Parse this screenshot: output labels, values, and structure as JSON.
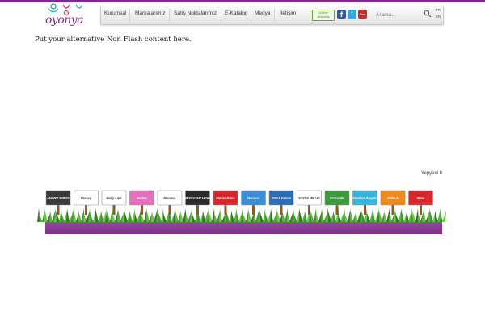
{
  "logo": {
    "text": "oyonya"
  },
  "nav": {
    "items": [
      {
        "label": "Kurumsal"
      },
      {
        "label": "Markalarımız"
      },
      {
        "label": "Satış Noktalarımız"
      },
      {
        "label": "E-Katalog"
      },
      {
        "label": "Medya"
      },
      {
        "label": "İletişim"
      }
    ],
    "online_store": {
      "line1": "Online",
      "line2": "Alışveriş"
    },
    "social": {
      "facebook": "f",
      "twitter": "t",
      "youtube": "You"
    },
    "search": {
      "placeholder": "Arama..."
    },
    "languages": [
      "TR",
      "EN"
    ]
  },
  "main": {
    "alt_content": "Put your alternative Non Flash content here."
  },
  "brands": {
    "caption": "Yepyeni b",
    "logos": [
      {
        "name": "ANGRY BIRDS",
        "color": "#3a3a3a"
      },
      {
        "name": "Disney",
        "color": "#ffffff"
      },
      {
        "name": "Baby Lips",
        "color": "#ffffff"
      },
      {
        "name": "Barbie",
        "color": "#e86fbf"
      },
      {
        "name": "Monkey",
        "color": "#ffffff"
      },
      {
        "name": "MONSTER HIGH",
        "color": "#2a2a2a"
      },
      {
        "name": "Fisher-Price",
        "color": "#d8262e"
      },
      {
        "name": "Nanuco",
        "color": "#3c8ed8"
      },
      {
        "name": "Sihirli Kalem",
        "color": "#2d6db8"
      },
      {
        "name": "STYLE ME UP",
        "color": "#ffffff"
      },
      {
        "name": "Crocodile",
        "color": "#3c9a3e"
      },
      {
        "name": "Fashion Angels",
        "color": "#36b6dc"
      },
      {
        "name": "ZOKLA",
        "color": "#f08a1c"
      },
      {
        "name": "Winx",
        "color": "#d8262e"
      }
    ]
  }
}
